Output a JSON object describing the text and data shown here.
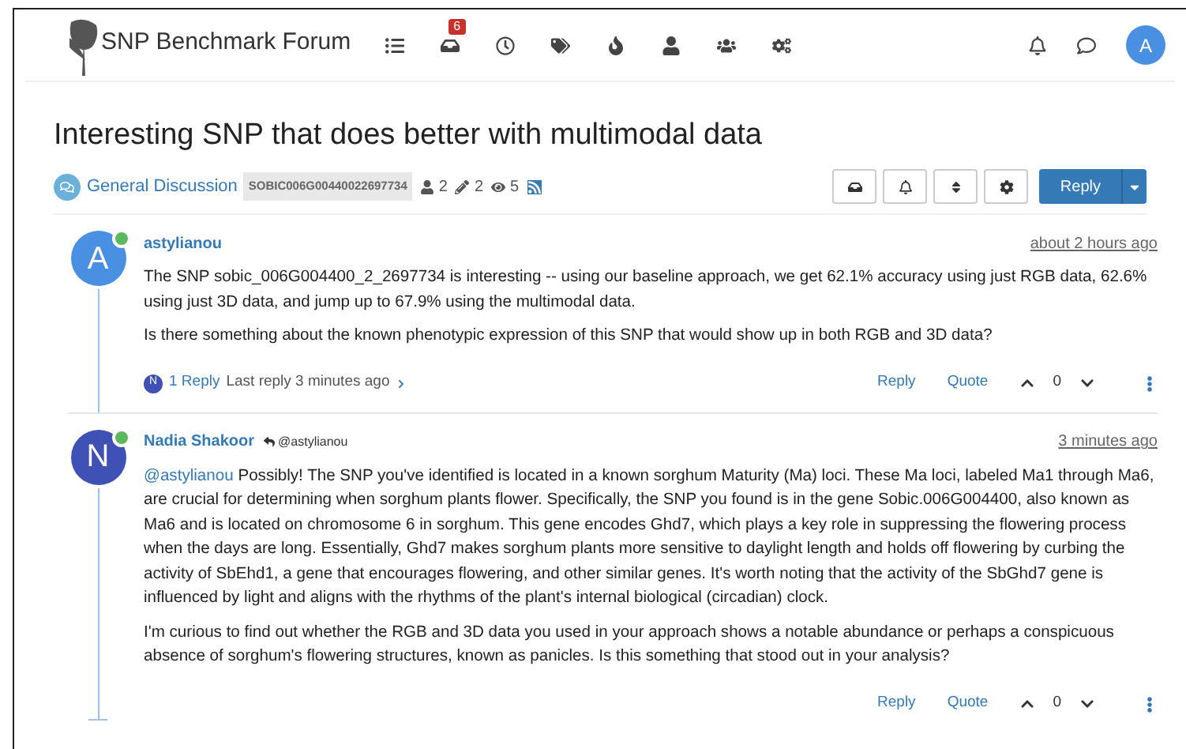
{
  "header": {
    "brand": "SNP Benchmark Forum",
    "nav": [
      {
        "kind": "list"
      },
      {
        "kind": "inbox",
        "badge": "6"
      },
      {
        "kind": "clock"
      },
      {
        "kind": "tags"
      },
      {
        "kind": "fire"
      },
      {
        "kind": "user"
      },
      {
        "kind": "users"
      },
      {
        "kind": "cogs"
      }
    ],
    "right": [
      {
        "kind": "bell"
      },
      {
        "kind": "chat"
      }
    ],
    "avatar": "A"
  },
  "topic": {
    "title": "Interesting SNP that does better with multimodal data",
    "category": "General Discussion",
    "tag": "SOBIC006G00440022697734",
    "stats": [
      {
        "kind": "posters",
        "value": "2"
      },
      {
        "kind": "posts",
        "value": "2"
      },
      {
        "kind": "views",
        "value": "5"
      }
    ],
    "tools": [
      {
        "kind": "inbox"
      },
      {
        "kind": "bell"
      },
      {
        "kind": "sort"
      },
      {
        "kind": "gear"
      }
    ],
    "reply_button": "Reply"
  },
  "posts": [
    {
      "avatar": "A",
      "color": "#4a90e2",
      "online": true,
      "author": "astylianou",
      "time": "about 2 hours ago",
      "paragraphs": [
        "The SNP sobic_006G004400_2_2697734 is interesting -- using our baseline approach, we get 62.1% accuracy using just RGB data, 62.6% using just 3D data, and jump up to 67.9% using the multimodal data.",
        "Is there something about the known phenotypic expression of this SNP that would show up in both RGB and 3D data?"
      ],
      "replies": {
        "avatar": "N",
        "link": "1 Reply",
        "last": "Last reply 3 minutes ago"
      },
      "actions": [
        "Reply",
        "Quote"
      ],
      "votes": "0"
    },
    {
      "avatar": "N",
      "color": "#3f51b5",
      "online": true,
      "author": "Nadia Shakoor",
      "reply_to": "@astylianou",
      "time": "3 minutes ago",
      "mention": "@astylianou",
      "paragraphs": [
        "Possibly! The SNP you've identified is located in a known sorghum Maturity (Ma) loci. These Ma loci, labeled Ma1 through Ma6, are crucial for determining when sorghum plants flower. Specifically, the SNP you found is in the gene Sobic.006G004400, also known as Ma6 and is located on chromosome 6 in sorghum. This gene encodes Ghd7, which plays a key role in suppressing the flowering process when the days are long. Essentially, Ghd7 makes sorghum plants more sensitive to daylight length and holds off flowering by curbing the activity of SbEhd1, a gene that encourages flowering, and other similar genes. It's worth noting that the activity of the SbGhd7 gene is influenced by light and aligns with the rhythms of the plant's internal biological (circadian) clock.",
        "I'm curious to find out whether the RGB and 3D data you used in your approach shows a notable abundance or perhaps a conspicuous absence of sorghum's flowering structures, known as panicles. Is this something that stood out in your analysis?"
      ],
      "actions": [
        "Reply",
        "Quote"
      ],
      "votes": "0"
    }
  ]
}
